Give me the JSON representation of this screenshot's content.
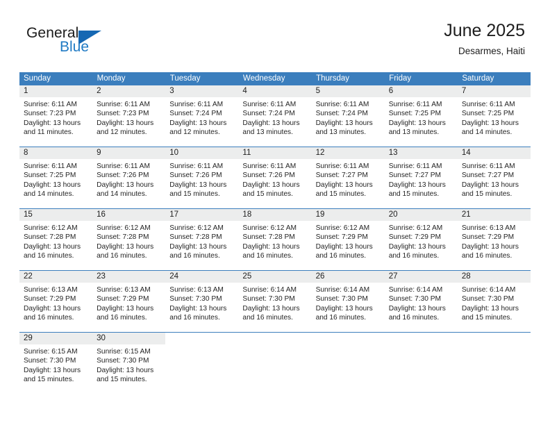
{
  "brand": {
    "name_part1": "General",
    "name_part2": "Blue",
    "flag_color": "#1668b3",
    "blue_text_color": "#1f7ac4"
  },
  "header": {
    "title": "June 2025",
    "subtitle": "Desarmes, Haiti"
  },
  "theme": {
    "header_row_bg": "#3b7ebd",
    "header_row_text": "#ffffff",
    "daynum_band_bg": "#eceded",
    "row_divider": "#3b7ebd",
    "body_text": "#242424"
  },
  "calendar": {
    "day_headers": [
      "Sunday",
      "Monday",
      "Tuesday",
      "Wednesday",
      "Thursday",
      "Friday",
      "Saturday"
    ],
    "weeks": [
      [
        {
          "day": "1",
          "sunrise": "Sunrise: 6:11 AM",
          "sunset": "Sunset: 7:23 PM",
          "daylight": "Daylight: 13 hours and 11 minutes."
        },
        {
          "day": "2",
          "sunrise": "Sunrise: 6:11 AM",
          "sunset": "Sunset: 7:23 PM",
          "daylight": "Daylight: 13 hours and 12 minutes."
        },
        {
          "day": "3",
          "sunrise": "Sunrise: 6:11 AM",
          "sunset": "Sunset: 7:24 PM",
          "daylight": "Daylight: 13 hours and 12 minutes."
        },
        {
          "day": "4",
          "sunrise": "Sunrise: 6:11 AM",
          "sunset": "Sunset: 7:24 PM",
          "daylight": "Daylight: 13 hours and 13 minutes."
        },
        {
          "day": "5",
          "sunrise": "Sunrise: 6:11 AM",
          "sunset": "Sunset: 7:24 PM",
          "daylight": "Daylight: 13 hours and 13 minutes."
        },
        {
          "day": "6",
          "sunrise": "Sunrise: 6:11 AM",
          "sunset": "Sunset: 7:25 PM",
          "daylight": "Daylight: 13 hours and 13 minutes."
        },
        {
          "day": "7",
          "sunrise": "Sunrise: 6:11 AM",
          "sunset": "Sunset: 7:25 PM",
          "daylight": "Daylight: 13 hours and 14 minutes."
        }
      ],
      [
        {
          "day": "8",
          "sunrise": "Sunrise: 6:11 AM",
          "sunset": "Sunset: 7:25 PM",
          "daylight": "Daylight: 13 hours and 14 minutes."
        },
        {
          "day": "9",
          "sunrise": "Sunrise: 6:11 AM",
          "sunset": "Sunset: 7:26 PM",
          "daylight": "Daylight: 13 hours and 14 minutes."
        },
        {
          "day": "10",
          "sunrise": "Sunrise: 6:11 AM",
          "sunset": "Sunset: 7:26 PM",
          "daylight": "Daylight: 13 hours and 15 minutes."
        },
        {
          "day": "11",
          "sunrise": "Sunrise: 6:11 AM",
          "sunset": "Sunset: 7:26 PM",
          "daylight": "Daylight: 13 hours and 15 minutes."
        },
        {
          "day": "12",
          "sunrise": "Sunrise: 6:11 AM",
          "sunset": "Sunset: 7:27 PM",
          "daylight": "Daylight: 13 hours and 15 minutes."
        },
        {
          "day": "13",
          "sunrise": "Sunrise: 6:11 AM",
          "sunset": "Sunset: 7:27 PM",
          "daylight": "Daylight: 13 hours and 15 minutes."
        },
        {
          "day": "14",
          "sunrise": "Sunrise: 6:11 AM",
          "sunset": "Sunset: 7:27 PM",
          "daylight": "Daylight: 13 hours and 15 minutes."
        }
      ],
      [
        {
          "day": "15",
          "sunrise": "Sunrise: 6:12 AM",
          "sunset": "Sunset: 7:28 PM",
          "daylight": "Daylight: 13 hours and 16 minutes."
        },
        {
          "day": "16",
          "sunrise": "Sunrise: 6:12 AM",
          "sunset": "Sunset: 7:28 PM",
          "daylight": "Daylight: 13 hours and 16 minutes."
        },
        {
          "day": "17",
          "sunrise": "Sunrise: 6:12 AM",
          "sunset": "Sunset: 7:28 PM",
          "daylight": "Daylight: 13 hours and 16 minutes."
        },
        {
          "day": "18",
          "sunrise": "Sunrise: 6:12 AM",
          "sunset": "Sunset: 7:28 PM",
          "daylight": "Daylight: 13 hours and 16 minutes."
        },
        {
          "day": "19",
          "sunrise": "Sunrise: 6:12 AM",
          "sunset": "Sunset: 7:29 PM",
          "daylight": "Daylight: 13 hours and 16 minutes."
        },
        {
          "day": "20",
          "sunrise": "Sunrise: 6:12 AM",
          "sunset": "Sunset: 7:29 PM",
          "daylight": "Daylight: 13 hours and 16 minutes."
        },
        {
          "day": "21",
          "sunrise": "Sunrise: 6:13 AM",
          "sunset": "Sunset: 7:29 PM",
          "daylight": "Daylight: 13 hours and 16 minutes."
        }
      ],
      [
        {
          "day": "22",
          "sunrise": "Sunrise: 6:13 AM",
          "sunset": "Sunset: 7:29 PM",
          "daylight": "Daylight: 13 hours and 16 minutes."
        },
        {
          "day": "23",
          "sunrise": "Sunrise: 6:13 AM",
          "sunset": "Sunset: 7:29 PM",
          "daylight": "Daylight: 13 hours and 16 minutes."
        },
        {
          "day": "24",
          "sunrise": "Sunrise: 6:13 AM",
          "sunset": "Sunset: 7:30 PM",
          "daylight": "Daylight: 13 hours and 16 minutes."
        },
        {
          "day": "25",
          "sunrise": "Sunrise: 6:14 AM",
          "sunset": "Sunset: 7:30 PM",
          "daylight": "Daylight: 13 hours and 16 minutes."
        },
        {
          "day": "26",
          "sunrise": "Sunrise: 6:14 AM",
          "sunset": "Sunset: 7:30 PM",
          "daylight": "Daylight: 13 hours and 16 minutes."
        },
        {
          "day": "27",
          "sunrise": "Sunrise: 6:14 AM",
          "sunset": "Sunset: 7:30 PM",
          "daylight": "Daylight: 13 hours and 16 minutes."
        },
        {
          "day": "28",
          "sunrise": "Sunrise: 6:14 AM",
          "sunset": "Sunset: 7:30 PM",
          "daylight": "Daylight: 13 hours and 15 minutes."
        }
      ],
      [
        {
          "day": "29",
          "sunrise": "Sunrise: 6:15 AM",
          "sunset": "Sunset: 7:30 PM",
          "daylight": "Daylight: 13 hours and 15 minutes."
        },
        {
          "day": "30",
          "sunrise": "Sunrise: 6:15 AM",
          "sunset": "Sunset: 7:30 PM",
          "daylight": "Daylight: 13 hours and 15 minutes."
        },
        {
          "day": "",
          "sunrise": "",
          "sunset": "",
          "daylight": ""
        },
        {
          "day": "",
          "sunrise": "",
          "sunset": "",
          "daylight": ""
        },
        {
          "day": "",
          "sunrise": "",
          "sunset": "",
          "daylight": ""
        },
        {
          "day": "",
          "sunrise": "",
          "sunset": "",
          "daylight": ""
        },
        {
          "day": "",
          "sunrise": "",
          "sunset": "",
          "daylight": ""
        }
      ]
    ]
  }
}
